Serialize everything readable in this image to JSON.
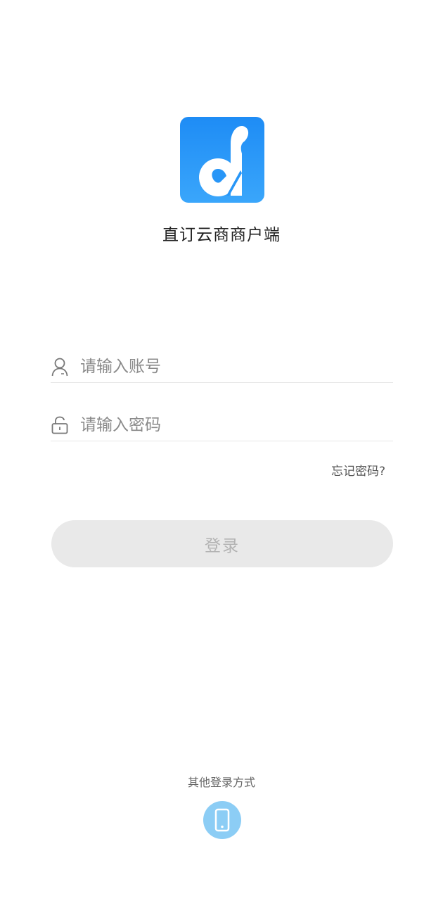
{
  "app": {
    "name": "直订云商商户端"
  },
  "login_form": {
    "account": {
      "placeholder": "请输入账号",
      "icon": "user-icon"
    },
    "password": {
      "placeholder": "请输入密码",
      "icon": "lock-icon"
    },
    "forgot_password": "忘记密码?",
    "login_button": "登录"
  },
  "other_login": {
    "label": "其他登录方式",
    "methods": [
      {
        "icon": "phone-icon"
      }
    ]
  },
  "colors": {
    "brand_blue": "#1e8cf5",
    "phone_button": "#8ccdf5",
    "login_button_disabled_bg": "#e9e9e9",
    "login_button_disabled_text": "#b3b3b3"
  }
}
